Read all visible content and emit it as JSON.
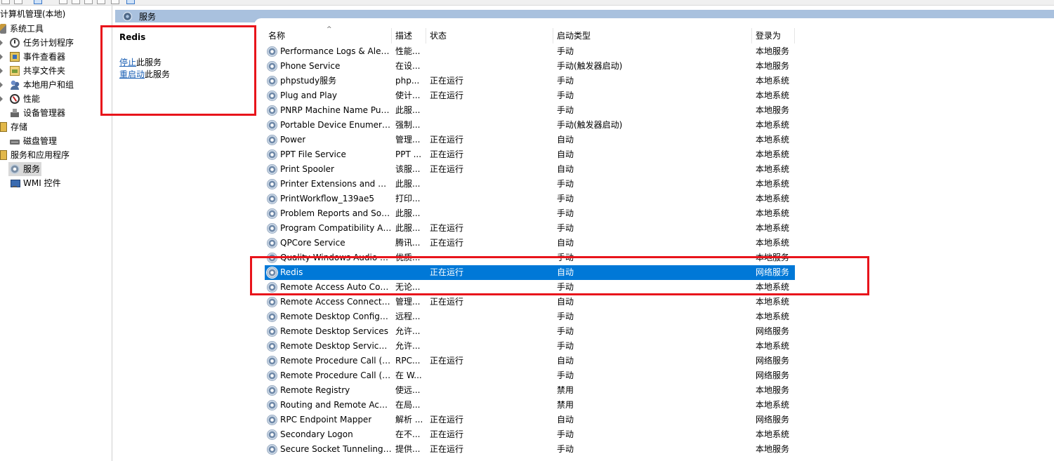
{
  "tree": {
    "root": "计算机管理(本地)",
    "items": [
      {
        "label": "系统工具",
        "icon": "tools-icon"
      },
      {
        "label": "任务计划程序",
        "icon": "clock-icon"
      },
      {
        "label": "事件查看器",
        "icon": "event-viewer-icon"
      },
      {
        "label": "共享文件夹",
        "icon": "shared-folder-icon"
      },
      {
        "label": "本地用户和组",
        "icon": "users-icon"
      },
      {
        "label": "性能",
        "icon": "performance-icon"
      },
      {
        "label": "设备管理器",
        "icon": "device-manager-icon"
      },
      {
        "label": "存储",
        "icon": "storage-icon"
      },
      {
        "label": "磁盘管理",
        "icon": "disk-icon"
      },
      {
        "label": "服务和应用程序",
        "icon": "none"
      },
      {
        "label": "服务",
        "icon": "services-icon"
      },
      {
        "label": "WMI 控件",
        "icon": "wmi-icon"
      }
    ]
  },
  "pane": {
    "title": "服务"
  },
  "detail": {
    "service_name": "Redis",
    "stop_link": "停止",
    "stop_suffix": "此服务",
    "restart_link": "重启动",
    "restart_suffix": "此服务"
  },
  "columns": {
    "name": "名称",
    "description": "描述",
    "status": "状态",
    "startup": "启动类型",
    "logon": "登录为"
  },
  "services": [
    {
      "name": "Performance Logs & Alerts",
      "desc": "性能...",
      "status": "",
      "startup": "手动",
      "logon": "本地服务"
    },
    {
      "name": "Phone Service",
      "desc": "在设...",
      "status": "",
      "startup": "手动(触发器启动)",
      "logon": "本地服务"
    },
    {
      "name": "phpstudy服务",
      "desc": "php...",
      "status": "正在运行",
      "startup": "手动",
      "logon": "本地系统"
    },
    {
      "name": "Plug and Play",
      "desc": "使计...",
      "status": "正在运行",
      "startup": "手动",
      "logon": "本地系统"
    },
    {
      "name": "PNRP Machine Name Publication Service",
      "desc": "此服...",
      "status": "",
      "startup": "手动",
      "logon": "本地服务"
    },
    {
      "name": "Portable Device Enumerator Service",
      "desc": "强制...",
      "status": "",
      "startup": "手动(触发器启动)",
      "logon": "本地系统"
    },
    {
      "name": "Power",
      "desc": "管理...",
      "status": "正在运行",
      "startup": "自动",
      "logon": "本地系统"
    },
    {
      "name": "PPT File Service",
      "desc": "PPT ...",
      "status": "正在运行",
      "startup": "自动",
      "logon": "本地系统"
    },
    {
      "name": "Print Spooler",
      "desc": "该服...",
      "status": "正在运行",
      "startup": "自动",
      "logon": "本地系统"
    },
    {
      "name": "Printer Extensions and Notifications",
      "desc": "此服...",
      "status": "",
      "startup": "手动",
      "logon": "本地系统"
    },
    {
      "name": "PrintWorkflow_139ae5",
      "desc": "打印...",
      "status": "",
      "startup": "手动",
      "logon": "本地系统"
    },
    {
      "name": "Problem Reports and Solutions Control Panel Support",
      "desc": "此服...",
      "status": "",
      "startup": "手动",
      "logon": "本地系统"
    },
    {
      "name": "Program Compatibility Assistant Service",
      "desc": "此服...",
      "status": "正在运行",
      "startup": "手动",
      "logon": "本地系统"
    },
    {
      "name": "QPCore Service",
      "desc": "腾讯...",
      "status": "正在运行",
      "startup": "自动",
      "logon": "本地系统"
    },
    {
      "name": "Quality Windows Audio Video Experience",
      "desc": "优质...",
      "status": "",
      "startup": "手动",
      "logon": "本地服务"
    },
    {
      "name": "Redis",
      "desc": "",
      "status": "正在运行",
      "startup": "自动",
      "logon": "网络服务"
    },
    {
      "name": "Remote Access Auto Connection Manager",
      "desc": "无论...",
      "status": "",
      "startup": "手动",
      "logon": "本地系统"
    },
    {
      "name": "Remote Access Connection Manager",
      "desc": "管理...",
      "status": "正在运行",
      "startup": "自动",
      "logon": "本地系统"
    },
    {
      "name": "Remote Desktop Configuration",
      "desc": "远程...",
      "status": "",
      "startup": "手动",
      "logon": "本地系统"
    },
    {
      "name": "Remote Desktop Services",
      "desc": "允许...",
      "status": "",
      "startup": "手动",
      "logon": "网络服务"
    },
    {
      "name": "Remote Desktop Services UserMode Port Redirector",
      "desc": "允许...",
      "status": "",
      "startup": "手动",
      "logon": "本地系统"
    },
    {
      "name": "Remote Procedure Call (RPC)",
      "desc": "RPC...",
      "status": "正在运行",
      "startup": "自动",
      "logon": "网络服务"
    },
    {
      "name": "Remote Procedure Call (RPC) Locator",
      "desc": "在 W...",
      "status": "",
      "startup": "手动",
      "logon": "网络服务"
    },
    {
      "name": "Remote Registry",
      "desc": "使远...",
      "status": "",
      "startup": "禁用",
      "logon": "本地服务"
    },
    {
      "name": "Routing and Remote Access",
      "desc": "在局...",
      "status": "",
      "startup": "禁用",
      "logon": "本地系统"
    },
    {
      "name": "RPC Endpoint Mapper",
      "desc": "解析 ...",
      "status": "正在运行",
      "startup": "自动",
      "logon": "网络服务"
    },
    {
      "name": "Secondary Logon",
      "desc": "在不...",
      "status": "正在运行",
      "startup": "手动",
      "logon": "本地系统"
    },
    {
      "name": "Secure Socket Tunneling Protocol Service",
      "desc": "提供...",
      "status": "正在运行",
      "startup": "手动",
      "logon": "本地服务"
    }
  ],
  "selected_service": "Redis",
  "colors": {
    "selection": "#0078d7",
    "header_bar": "#a9c1de",
    "annotation": "#e8141b",
    "link": "#1a5fb4"
  }
}
